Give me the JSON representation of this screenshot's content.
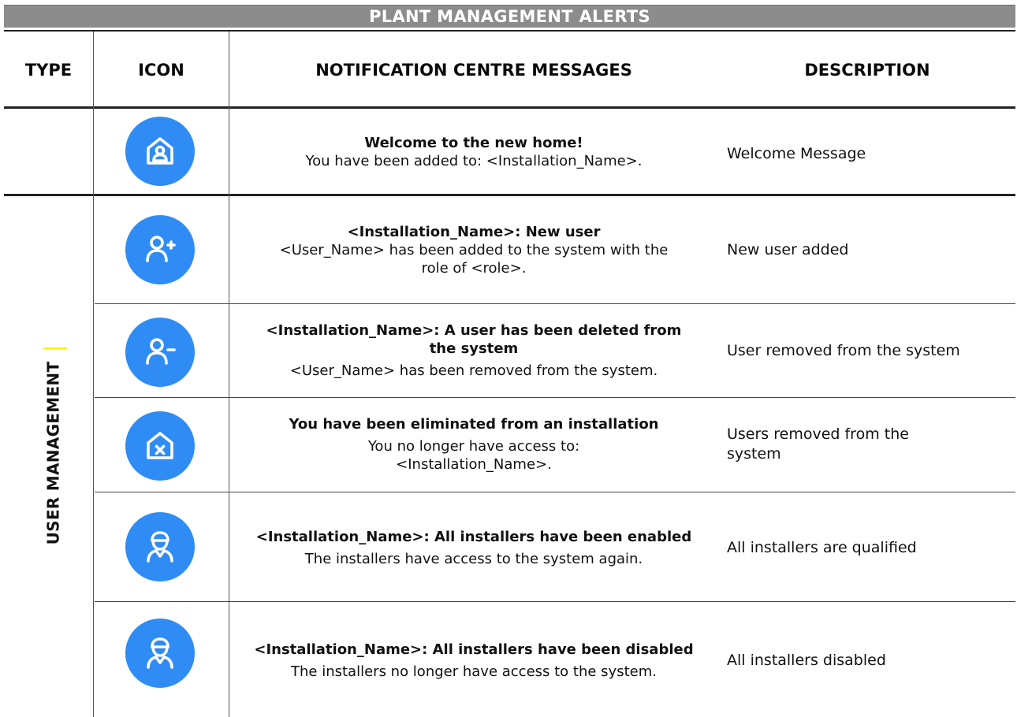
{
  "title": "PLANT MANAGEMENT ALERTS",
  "columns": {
    "type": "TYPE",
    "icon": "ICON",
    "messages": "NOTIFICATION CENTRE MESSAGES",
    "description": "DESCRIPTION"
  },
  "section_label": "USER MANAGEMENT",
  "rows": [
    {
      "icon": "home-user-icon",
      "title": "Welcome to the new home!",
      "body": "You have been added to: <Installation_Name>.",
      "description": "Welcome Message"
    },
    {
      "icon": "user-add-icon",
      "title": "<Installation_Name>: New user",
      "body": "<User_Name> has been added to the system with the role of <role>.",
      "description": "New user added"
    },
    {
      "icon": "user-remove-icon",
      "title": "<Installation_Name>: A user has been deleted from the system",
      "body": "<User_Name> has been removed from the system.",
      "description": "User removed from the system"
    },
    {
      "icon": "home-remove-icon",
      "title": "You have been eliminated from an installation",
      "body": "You no longer have access to: <Installation_Name>.",
      "description": "Users removed from the system"
    },
    {
      "icon": "installer-icon",
      "title": "<Installation_Name>: All installers have been enabled",
      "body": "The installers have access to the system again.",
      "description": "All installers are qualified"
    },
    {
      "icon": "installer-icon",
      "title": "<Installation_Name>: All installers have been disabled",
      "body": "The installers no longer have access to the system.",
      "description": "All installers disabled"
    }
  ],
  "colors": {
    "banner": "#8c8c8c",
    "icon_background": "#2f8cf4"
  }
}
